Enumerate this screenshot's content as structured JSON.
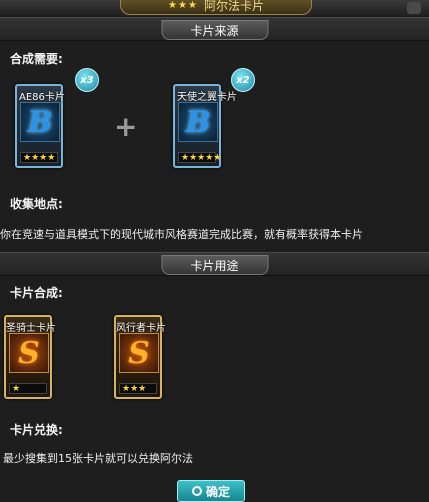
{
  "window": {
    "title": "阿尔法卡片",
    "title_stars": "★★★"
  },
  "source_section": {
    "tab_label": "卡片来源"
  },
  "synthesis": {
    "label": "合成需要:",
    "plus": "+",
    "cards": [
      {
        "name": "AE86卡片",
        "letter": "B",
        "stars": "★★★★",
        "badge": "x3"
      },
      {
        "name": "天使之翼卡片",
        "letter": "B",
        "stars": "★★★★★",
        "badge": "x2"
      }
    ]
  },
  "collect": {
    "label": "收集地点:",
    "text": "你在竞速与道具模式下的现代城市风格赛道完成比赛，就有概率获得本卡片"
  },
  "usage_section": {
    "tab_label": "卡片用途"
  },
  "usage": {
    "label": "卡片合成:",
    "cards": [
      {
        "name": "圣骑士卡片",
        "letter": "S",
        "stars": "★"
      },
      {
        "name": "风行者卡片",
        "letter": "S",
        "stars": "★★★"
      }
    ]
  },
  "exchange": {
    "label": "卡片兑换:",
    "text": "最少搜集到15张卡片就可以兑换阿尔法"
  },
  "confirm_button": {
    "label": "确定"
  }
}
